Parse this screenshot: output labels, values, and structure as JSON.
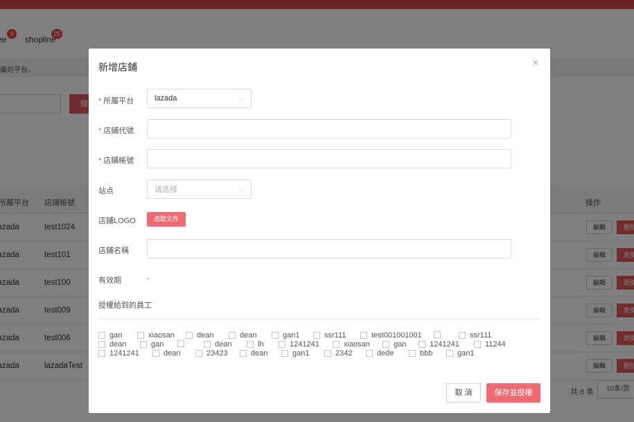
{
  "background": {
    "tabs": [
      {
        "label": "ee",
        "badge": "3"
      },
      {
        "label": "shopline",
        "badge": "25"
      }
    ],
    "notice": "屬的平台。",
    "search_label": "搜",
    "table": {
      "headers": {
        "platform": "所屬平台",
        "account": "店鋪帳號",
        "actions": "操作"
      },
      "rows": [
        {
          "platform": "lazada",
          "account": "test1024",
          "edit": "編輯",
          "delete": "刪除"
        },
        {
          "platform": "lazada",
          "account": "test101",
          "edit": "編輯",
          "delete": "更換"
        },
        {
          "platform": "lazada",
          "account": "test100",
          "edit": "編輯",
          "delete": "更換"
        },
        {
          "platform": "lazada",
          "account": "test009",
          "edit": "編輯",
          "delete": "更換"
        },
        {
          "platform": "lazada",
          "account": "test006",
          "edit": "編輯",
          "delete": "更換"
        },
        {
          "platform": "lazada",
          "account": "lazadaTest",
          "edit": "編輯",
          "delete": "刪除"
        }
      ]
    },
    "pager": {
      "total": "共 6 条",
      "page_size": "10条/页"
    }
  },
  "modal": {
    "title": "新增店鋪",
    "close_icon": "×",
    "required_mark": "*",
    "chevron": "⌵",
    "fields": {
      "platform": {
        "label": "所屬平台",
        "value": "lazada"
      },
      "shop_code": {
        "label": "店鋪代號",
        "value": ""
      },
      "shop_account": {
        "label": "店鋪帳號",
        "value": ""
      },
      "site": {
        "label": "站点",
        "placeholder": "请选择"
      },
      "logo": {
        "label": "店鋪LOGO",
        "button": "选取文件"
      },
      "shop_name": {
        "label": "店鋪名稱",
        "value": ""
      },
      "validity": {
        "label": "有效期",
        "value": "-"
      },
      "employees": {
        "label": "授權給到的員工"
      }
    },
    "employees": [
      [
        "gan",
        "xiaosan",
        "dean",
        "dean",
        "gan1",
        "ssr111",
        "test001001001",
        "",
        "ssr111"
      ],
      [
        "dean",
        "gan",
        "",
        "dean",
        "lh",
        "1241241",
        "xiaosan",
        "gan",
        "1241241",
        "11244"
      ],
      [
        "1241241",
        "dean",
        "23423",
        "dean",
        "gan1",
        "2342",
        "dede",
        "bbb",
        "gan1"
      ]
    ],
    "cancel_label": "取 消",
    "save_label": "保存並授權"
  }
}
